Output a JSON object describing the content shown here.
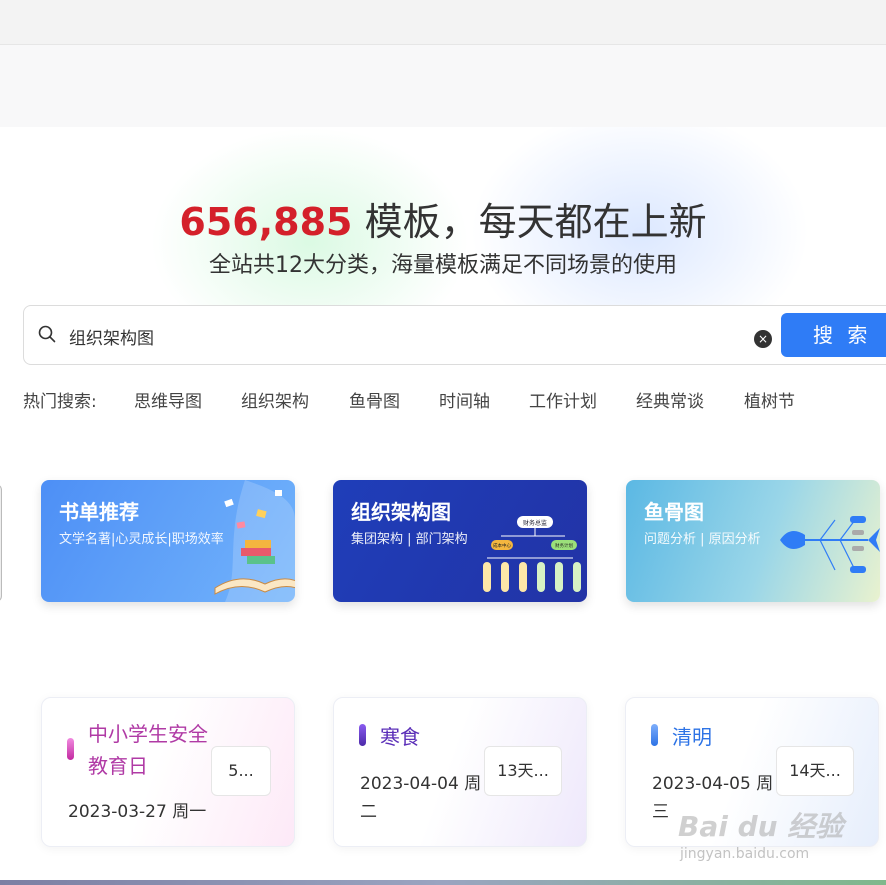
{
  "hero": {
    "count": "656,885",
    "headline_rest": " 模板，每天都在上新",
    "subline": "全站共12大分类，海量模板满足不同场景的使用"
  },
  "search": {
    "value": "组织架构图",
    "button_label": "搜 索",
    "clear_glyph": "×"
  },
  "hot_search": {
    "label": "热门搜索:",
    "items": [
      "思维导图",
      "组织架构",
      "鱼骨图",
      "时间轴",
      "工作计划",
      "经典常谈",
      "植树节"
    ]
  },
  "category_cards": [
    {
      "title": "书单推荐",
      "subtitle": "文学名著|心灵成长|职场效率",
      "illustration_icon": "open-book-icon"
    },
    {
      "title": "组织架构图",
      "subtitle": "集团架构 | 部门架构",
      "illustration_icon": "org-chart-icon",
      "diagram_root_label": "财务总监",
      "diagram_branch_labels": [
        "成本中心",
        "财务计划"
      ]
    },
    {
      "title": "鱼骨图",
      "subtitle": "问题分析 | 原因分析",
      "illustration_icon": "fishbone-icon"
    }
  ],
  "festivals": [
    {
      "title_line1": "中小学生安全",
      "title_line2": "教育日",
      "date": "2023-03-27 周一",
      "badge": "5...",
      "color": "#b03aa5",
      "bar_color": "#e35bc3"
    },
    {
      "title_line1": "寒食",
      "date_line1": "2023-04-04 周",
      "date_line2": "二",
      "badge": "13天...",
      "color": "#5b2fb8",
      "bar_color": "#6a3ccd"
    },
    {
      "title_line1": "清明",
      "date_line1": "2023-04-05 周",
      "date_line2": "三",
      "badge": "14天...",
      "color": "#2d73e6",
      "bar_color": "#4a8cf5"
    }
  ],
  "watermark": {
    "brand": "Bai du 经验",
    "url": "jingyan.baidu.com"
  }
}
